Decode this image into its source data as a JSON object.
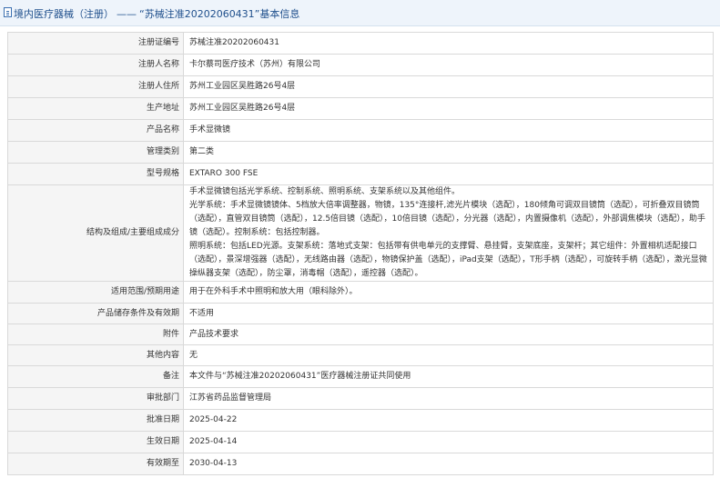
{
  "header": {
    "breadcrumb_link": "境内医疗器械（注册）",
    "separator": "——",
    "title": "“苏械注准20202060431”基本信息"
  },
  "rows": [
    {
      "label": "注册证编号",
      "value": "苏械注准20202060431"
    },
    {
      "label": "注册人名称",
      "value": "卡尔蔡司医疗技术（苏州）有限公司"
    },
    {
      "label": "注册人住所",
      "value": "苏州工业园区吴胜路26号4层"
    },
    {
      "label": "生产地址",
      "value": "苏州工业园区吴胜路26号4层"
    },
    {
      "label": "产品名称",
      "value": "手术显微镜"
    },
    {
      "label": "管理类别",
      "value": "第二类"
    },
    {
      "label": "型号规格",
      "value": "EXTARO 300 FSE"
    },
    {
      "label": "结构及组成/主要组成成分",
      "value_lines": [
        "手术显微镜包括光学系统、控制系统、照明系统、支架系统以及其他组件。",
        "光学系统：手术显微镜镜体、5档放大倍率调整器，物镜，135°连接杆,滤光片模块（选配），180倾角可调双目镜筒（选配），可折叠双目镜筒（选配），直管双目镜筒（选配），12.5倍目镜（选配），10倍目镜（选配），分光器（选配），内置摄像机（选配），外部调焦模块（选配），助手镜（选配）。控制系统：包括控制器。",
        "照明系统：包括LED光源。支架系统：落地式支架：包括带有供电单元的支撑臂、悬挂臂，支架底座，支架杆；其它组件：外置相机适配接口（选配），景深增强器（选配），无线路由器（选配），物镜保护盖（选配），iPad支架（选配），T形手柄（选配），可旋转手柄（选配），激光显微操纵器支架（选配），防尘罩，消毒帽（选配），遥控器（选配）。"
      ]
    },
    {
      "label": "适用范围/预期用途",
      "value": "用于在外科手术中照明和放大用（眼科除外）。"
    },
    {
      "label": "产品储存条件及有效期",
      "value": "不适用"
    },
    {
      "label": "附件",
      "value": "产品技术要求"
    },
    {
      "label": "其他内容",
      "value": "无"
    },
    {
      "label": "备注",
      "value": "本文件与“苏械注准20202060431”医疗器械注册证共同使用"
    },
    {
      "label": "审批部门",
      "value": "江苏省药品监督管理局"
    },
    {
      "label": "批准日期",
      "value": "2025-04-22"
    },
    {
      "label": "生效日期",
      "value": "2025-04-14"
    },
    {
      "label": "有效期至",
      "value": "2030-04-13"
    }
  ]
}
